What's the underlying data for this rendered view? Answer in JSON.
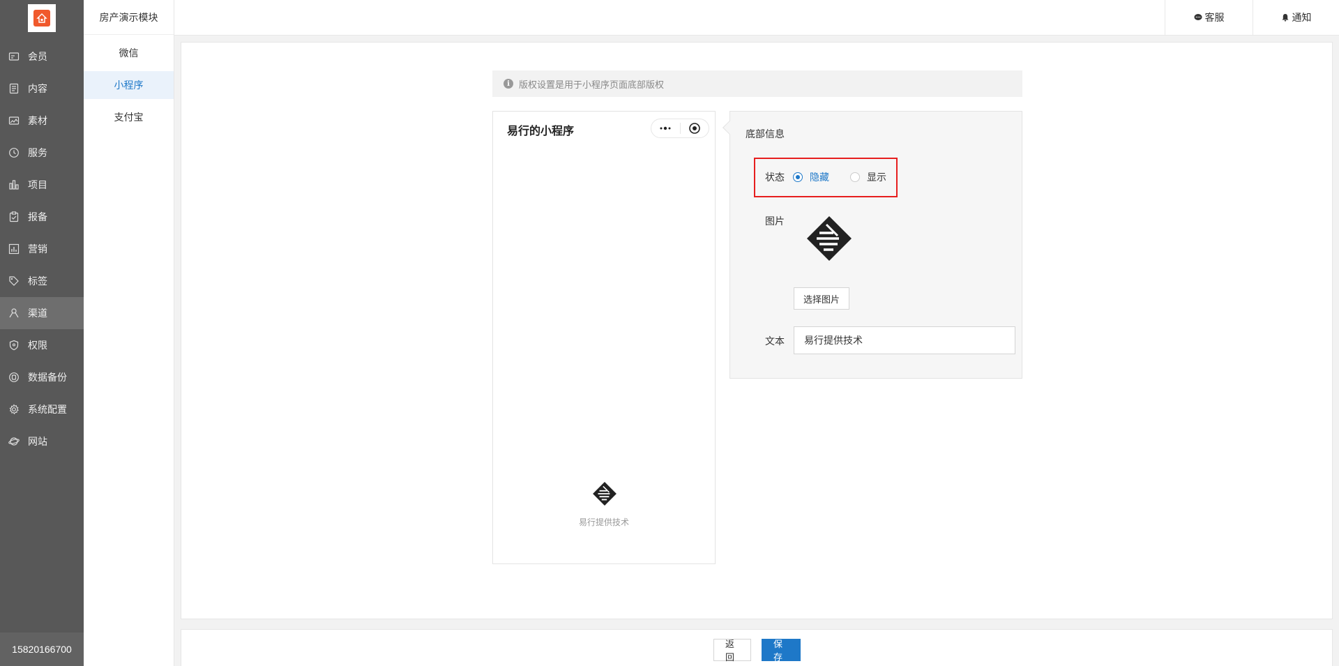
{
  "sidebar": {
    "items": [
      {
        "label": "会员",
        "icon": "member-card-icon"
      },
      {
        "label": "内容",
        "icon": "document-icon"
      },
      {
        "label": "素材",
        "icon": "image-icon"
      },
      {
        "label": "服务",
        "icon": "clock-icon"
      },
      {
        "label": "项目",
        "icon": "building-icon"
      },
      {
        "label": "报备",
        "icon": "clipboard-icon"
      },
      {
        "label": "营销",
        "icon": "chart-icon"
      },
      {
        "label": "标签",
        "icon": "tag-icon"
      },
      {
        "label": "渠道",
        "icon": "channel-icon"
      },
      {
        "label": "权限",
        "icon": "shield-icon"
      },
      {
        "label": "数据备份",
        "icon": "database-icon"
      },
      {
        "label": "系统配置",
        "icon": "gear-icon"
      },
      {
        "label": "网站",
        "icon": "globe-icon"
      }
    ],
    "active_index": 8,
    "phone": "15820166700"
  },
  "subnav": {
    "title": "房产演示模块",
    "items": [
      "微信",
      "小程序",
      "支付宝"
    ],
    "active_index": 1
  },
  "header": {
    "service_label": "客服",
    "notice_label": "通知"
  },
  "tip": "版权设置是用于小程序页面底部版权",
  "preview": {
    "title": "易行的小程序",
    "footer_text": "易行提供技术"
  },
  "settings": {
    "title": "底部信息",
    "status_label": "状态",
    "status_options": [
      "隐藏",
      "显示"
    ],
    "status_selected": "隐藏",
    "image_label": "图片",
    "choose_image_label": "选择图片",
    "text_label": "文本",
    "text_value": "易行提供技术"
  },
  "footer": {
    "back_label": "返回",
    "save_label": "保存"
  },
  "colors": {
    "accent": "#1e78c8",
    "highlight": "#e61e1e",
    "sidebar": "#585858",
    "logo": "#f0592c"
  }
}
